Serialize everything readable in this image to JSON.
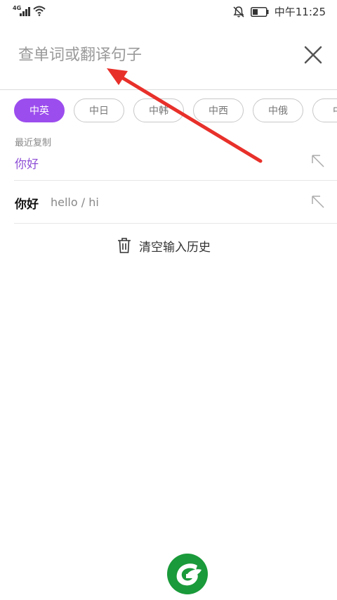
{
  "status_bar": {
    "network": "4G",
    "time": "中午11:25",
    "icons": [
      "signal-icon",
      "wifi-icon",
      "bell-muted-icon",
      "battery-icon"
    ]
  },
  "search": {
    "placeholder": "查单词或翻译句子",
    "value": ""
  },
  "language_tabs": [
    {
      "label": "中英",
      "active": true
    },
    {
      "label": "中日",
      "active": false
    },
    {
      "label": "中韩",
      "active": false
    },
    {
      "label": "中西",
      "active": false
    },
    {
      "label": "中俄",
      "active": false
    },
    {
      "label": "中",
      "active": false
    }
  ],
  "recent_copy": {
    "label": "最近复制",
    "text": "你好"
  },
  "history": [
    {
      "word": "你好",
      "translation": "hello / hi"
    }
  ],
  "clear_history": {
    "label": "清空输入历史",
    "icon": "trash-icon"
  },
  "colors": {
    "accent": "#9c4dee",
    "recent_text": "#8e4fd6",
    "annotation_arrow": "#e8302a",
    "logo_green": "#1a9a3a"
  }
}
